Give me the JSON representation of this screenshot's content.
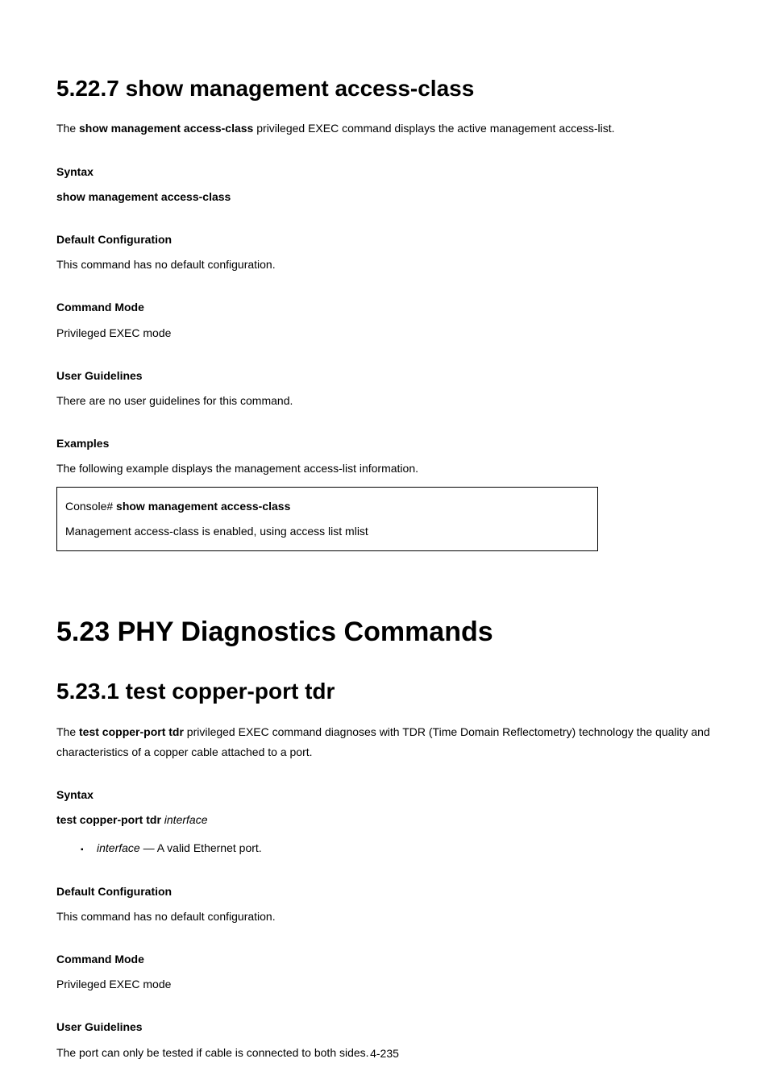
{
  "section1": {
    "title": "5.22.7 show management access-class",
    "intro_pre": "The ",
    "intro_cmd": "show management access-class",
    "intro_post": " privileged EXEC command displays the active management access-list.",
    "syntax_h": "Syntax",
    "syntax_cmd": "show management access-class",
    "default_h": "Default Configuration",
    "default_p": "This command has no default configuration.",
    "mode_h": "Command Mode",
    "mode_p": "Privileged EXEC mode",
    "guidelines_h": "User Guidelines",
    "guidelines_p": "There are no user guidelines for this command.",
    "examples_h": "Examples",
    "examples_p": "The following example displays the management access-list information.",
    "code_line1_pre": "Console# ",
    "code_line1_cmd": "show management access-class",
    "code_line2": "Management access-class is enabled, using access list mlist"
  },
  "chapter": {
    "title": "5.23 PHY Diagnostics Commands"
  },
  "section2": {
    "title": "5.23.1 test copper-port tdr",
    "intro_pre": "The ",
    "intro_cmd": "test copper-port tdr",
    "intro_post": " privileged EXEC command diagnoses with TDR (Time Domain Reflectometry) technology the quality and characteristics of a copper cable attached to a port.",
    "syntax_h": "Syntax",
    "syntax_cmd_pre": "test copper-port tdr ",
    "syntax_cmd_arg": "interface",
    "bullet_arg": "interface",
    "bullet_desc": " — A valid Ethernet port.",
    "default_h": "Default Configuration",
    "default_p": "This command has no default configuration.",
    "mode_h": "Command Mode",
    "mode_p": "Privileged EXEC mode",
    "guidelines_h": "User Guidelines",
    "guidelines_p": "The port can only be tested if cable is connected to both sides."
  },
  "footer": {
    "page": "4-235"
  }
}
